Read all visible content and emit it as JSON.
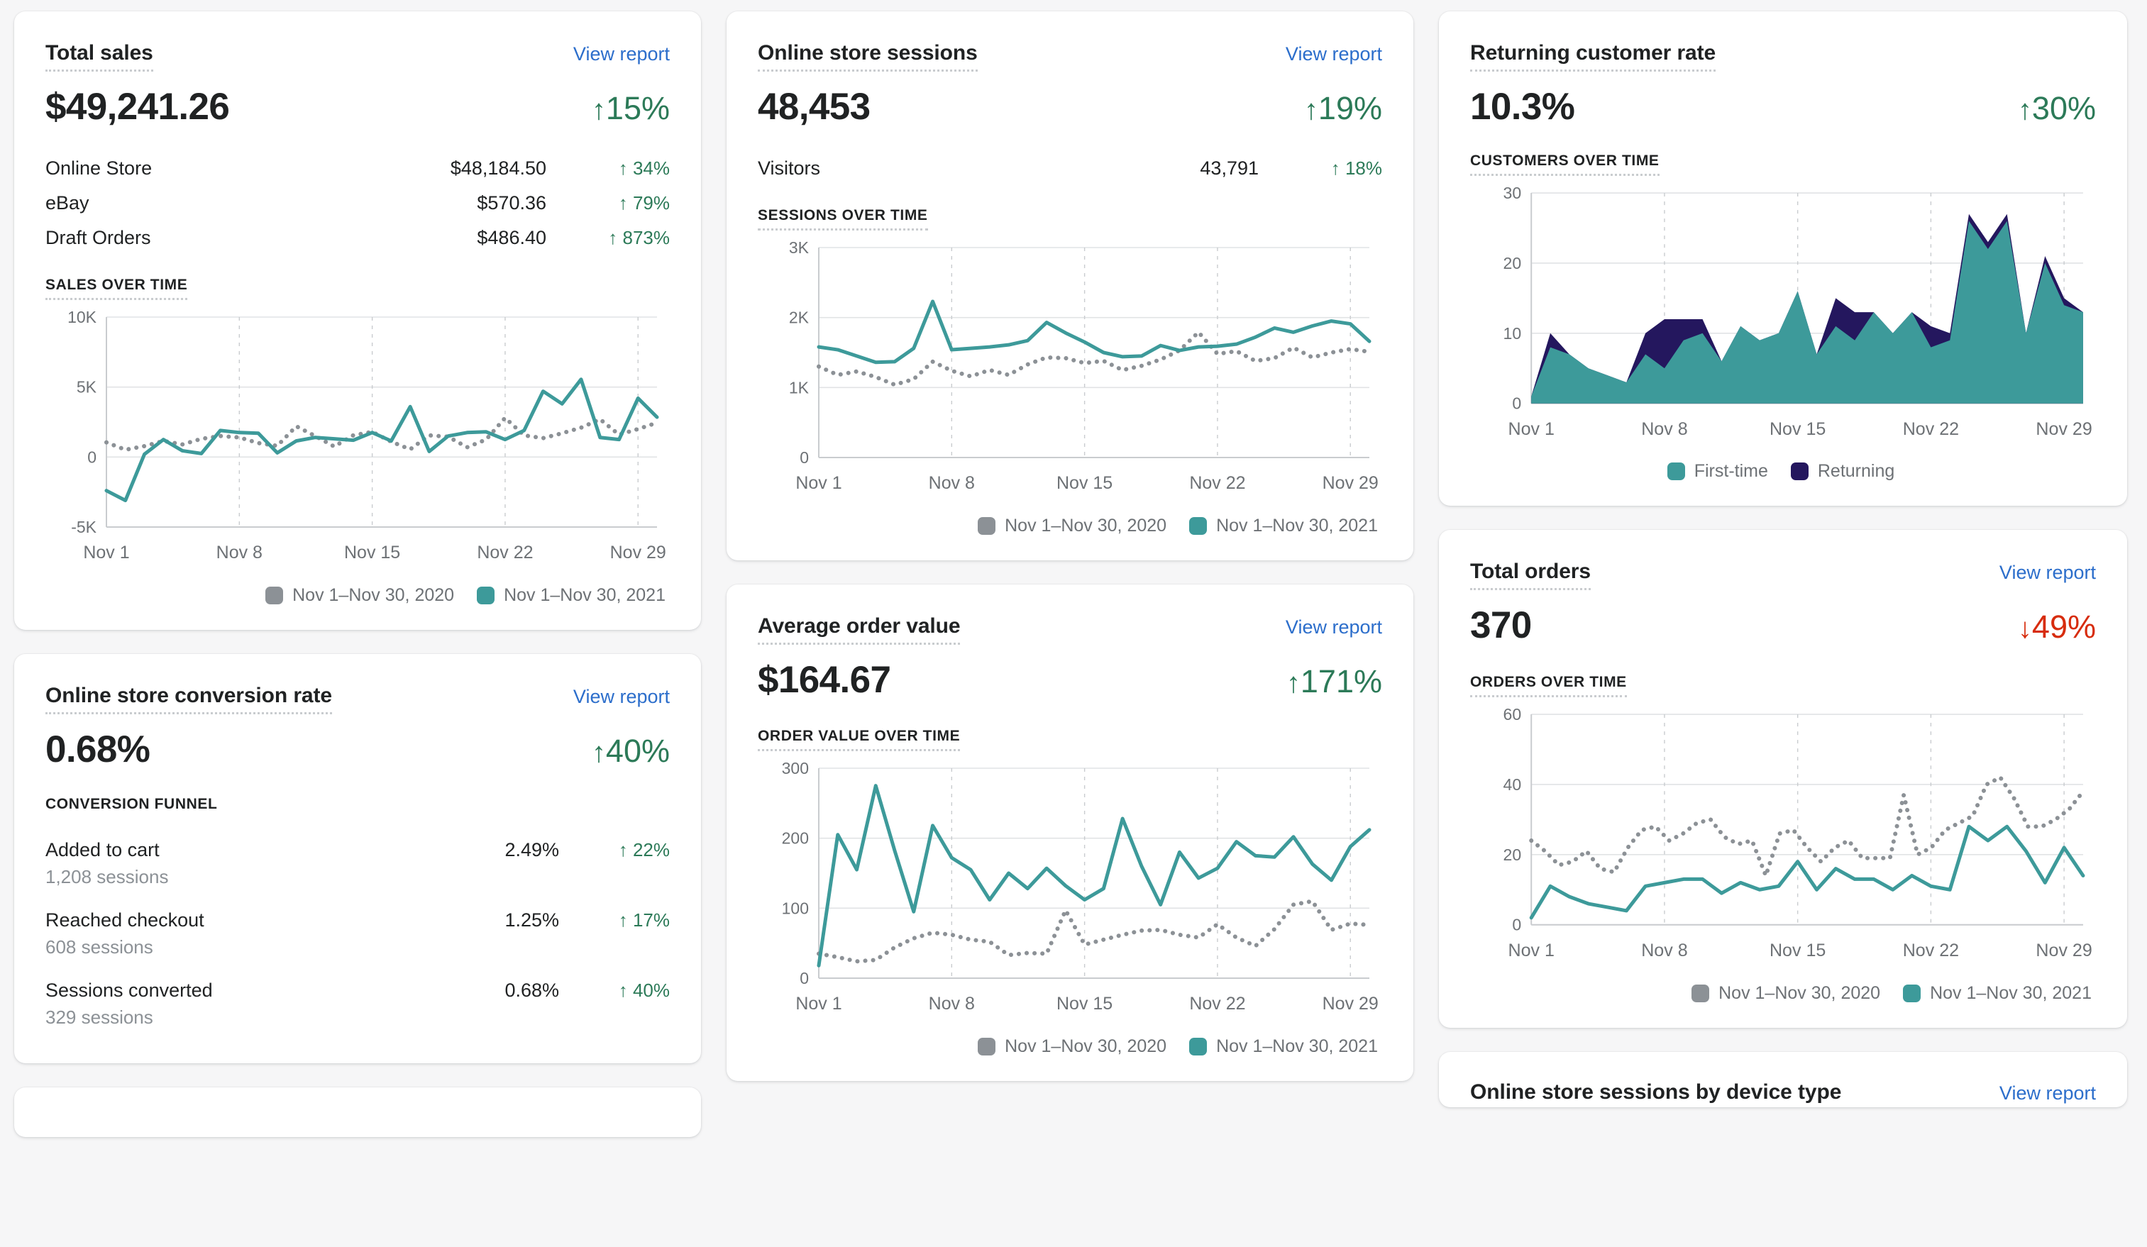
{
  "colors": {
    "accent_teal": "#3d9a9a",
    "accent_navy": "#24175e",
    "compare_gray": "#8c9196",
    "positive": "#2c7a58",
    "negative": "#d72c0d",
    "link": "#2c6ecb",
    "text": "#202223",
    "page_bg": "#f6f6f7"
  },
  "common": {
    "view_report": "View report",
    "legend_2020": "Nov 1–Nov 30, 2020",
    "legend_2021": "Nov 1–Nov 30, 2021",
    "x_ticks": [
      "Nov 1",
      "Nov 8",
      "Nov 15",
      "Nov 22",
      "Nov 29"
    ]
  },
  "cards": {
    "total_sales": {
      "title": "Total sales",
      "value": "$49,241.26",
      "delta": "15%",
      "delta_dir": "up",
      "delta_arrow": "↑",
      "rows": [
        {
          "label": "Online Store",
          "value": "$48,184.50",
          "change": "34%",
          "dir": "up",
          "arrow": "↑"
        },
        {
          "label": "eBay",
          "value": "$570.36",
          "change": "79%",
          "dir": "up",
          "arrow": "↑"
        },
        {
          "label": "Draft Orders",
          "value": "$486.40",
          "change": "873%",
          "dir": "up",
          "arrow": "↑"
        }
      ],
      "chart_label": "SALES OVER TIME"
    },
    "conversion_rate": {
      "title": "Online store conversion rate",
      "value": "0.68%",
      "delta": "40%",
      "delta_dir": "up",
      "delta_arrow": "↑",
      "funnel_label": "CONVERSION FUNNEL",
      "funnel": [
        {
          "label": "Added to cart",
          "sub": "1,208 sessions",
          "value": "2.49%",
          "change": "22%",
          "dir": "up",
          "arrow": "↑"
        },
        {
          "label": "Reached checkout",
          "sub": "608 sessions",
          "value": "1.25%",
          "change": "17%",
          "dir": "up",
          "arrow": "↑"
        },
        {
          "label": "Sessions converted",
          "sub": "329 sessions",
          "value": "0.68%",
          "change": "40%",
          "dir": "up",
          "arrow": "↑"
        }
      ]
    },
    "sessions": {
      "title": "Online store sessions",
      "value": "48,453",
      "delta": "19%",
      "delta_dir": "up",
      "delta_arrow": "↑",
      "rows": [
        {
          "label": "Visitors",
          "value": "43,791",
          "change": "18%",
          "dir": "up",
          "arrow": "↑"
        }
      ],
      "chart_label": "SESSIONS OVER TIME"
    },
    "average_order_value": {
      "title": "Average order value",
      "value": "$164.67",
      "delta": "171%",
      "delta_dir": "up",
      "delta_arrow": "↑",
      "chart_label": "ORDER VALUE OVER TIME"
    },
    "returning_customer_rate": {
      "title": "Returning customer rate",
      "value": "10.3%",
      "delta": "30%",
      "delta_dir": "up",
      "delta_arrow": "↑",
      "chart_label": "CUSTOMERS OVER TIME",
      "legend_first": "First-time",
      "legend_returning": "Returning"
    },
    "total_orders": {
      "title": "Total orders",
      "value": "370",
      "delta": "49%",
      "delta_dir": "down",
      "delta_arrow": "↓",
      "chart_label": "ORDERS OVER TIME"
    },
    "device_type": {
      "title": "Online store sessions by device type"
    }
  },
  "chart_data": [
    {
      "id": "sales_over_time",
      "type": "line",
      "title": "SALES OVER TIME",
      "xlabel": "",
      "ylabel": "",
      "ylim": [
        -5000,
        10000
      ],
      "y_ticks": [
        "-5K",
        "0",
        "5K",
        "10K"
      ],
      "y_tick_values": [
        -5000,
        0,
        5000,
        10000
      ],
      "x": [
        "Nov 1",
        "Nov 2",
        "Nov 3",
        "Nov 4",
        "Nov 5",
        "Nov 6",
        "Nov 7",
        "Nov 8",
        "Nov 9",
        "Nov 10",
        "Nov 11",
        "Nov 12",
        "Nov 13",
        "Nov 14",
        "Nov 15",
        "Nov 16",
        "Nov 17",
        "Nov 18",
        "Nov 19",
        "Nov 20",
        "Nov 21",
        "Nov 22",
        "Nov 23",
        "Nov 24",
        "Nov 25",
        "Nov 26",
        "Nov 27",
        "Nov 28",
        "Nov 29",
        "Nov 30"
      ],
      "x_ticks": [
        "Nov 1",
        "Nov 8",
        "Nov 15",
        "Nov 22",
        "Nov 29"
      ],
      "grid": true,
      "legend_position": "bottom-right",
      "series": [
        {
          "name": "Nov 1–Nov 30, 2020",
          "style": "dotted",
          "color": "#8c9196",
          "values": [
            1050,
            520,
            780,
            1150,
            900,
            1300,
            1500,
            1400,
            1000,
            800,
            2200,
            1500,
            750,
            1550,
            1800,
            1100,
            550,
            1550,
            1450,
            700,
            1250,
            2800,
            1550,
            1350,
            1700,
            2100,
            2700,
            1600,
            2000,
            2450
          ]
        },
        {
          "name": "Nov 1–Nov 30, 2021",
          "style": "solid",
          "color": "#3d9a9a",
          "values": [
            -2400,
            -3100,
            200,
            1250,
            450,
            250,
            1900,
            1750,
            1700,
            300,
            1150,
            1400,
            1300,
            1200,
            1750,
            1150,
            3600,
            400,
            1500,
            1750,
            1800,
            1250,
            1900,
            4700,
            3800,
            5550,
            1400,
            1250,
            4200,
            2850
          ]
        }
      ]
    },
    {
      "id": "sessions_over_time",
      "type": "line",
      "title": "SESSIONS OVER TIME",
      "ylim": [
        0,
        3000
      ],
      "y_ticks": [
        "0",
        "1K",
        "2K",
        "3K"
      ],
      "y_tick_values": [
        0,
        1000,
        2000,
        3000
      ],
      "x_ticks": [
        "Nov 1",
        "Nov 8",
        "Nov 15",
        "Nov 22",
        "Nov 29"
      ],
      "grid": true,
      "legend_position": "bottom-right",
      "series": [
        {
          "name": "Nov 1–Nov 30, 2020",
          "style": "dotted",
          "color": "#8c9196",
          "values": [
            1300,
            1180,
            1230,
            1150,
            1040,
            1120,
            1370,
            1240,
            1160,
            1250,
            1180,
            1330,
            1430,
            1420,
            1350,
            1380,
            1250,
            1310,
            1400,
            1530,
            1790,
            1480,
            1520,
            1380,
            1420,
            1570,
            1430,
            1500,
            1550,
            1510
          ]
        },
        {
          "name": "Nov 1–Nov 30, 2021",
          "style": "solid",
          "color": "#3d9a9a",
          "values": [
            1580,
            1540,
            1450,
            1360,
            1370,
            1560,
            2230,
            1540,
            1560,
            1580,
            1610,
            1670,
            1930,
            1780,
            1650,
            1500,
            1440,
            1450,
            1600,
            1530,
            1580,
            1590,
            1620,
            1720,
            1850,
            1790,
            1880,
            1950,
            1910,
            1660
          ]
        }
      ]
    },
    {
      "id": "order_value_over_time",
      "type": "line",
      "title": "ORDER VALUE OVER TIME",
      "ylim": [
        0,
        300
      ],
      "y_ticks": [
        "0",
        "100",
        "200",
        "300"
      ],
      "y_tick_values": [
        0,
        100,
        200,
        300
      ],
      "x_ticks": [
        "Nov 1",
        "Nov 8",
        "Nov 15",
        "Nov 22",
        "Nov 29"
      ],
      "grid": true,
      "legend_position": "bottom-right",
      "series": [
        {
          "name": "Nov 1–Nov 30, 2020",
          "style": "dotted",
          "color": "#8c9196",
          "values": [
            35,
            30,
            24,
            26,
            44,
            57,
            65,
            62,
            55,
            52,
            33,
            36,
            35,
            97,
            48,
            55,
            62,
            68,
            69,
            62,
            58,
            77,
            58,
            46,
            70,
            105,
            110,
            69,
            78,
            76
          ]
        },
        {
          "name": "Nov 1–Nov 30, 2021",
          "style": "solid",
          "color": "#3d9a9a",
          "values": [
            18,
            205,
            155,
            275,
            182,
            95,
            218,
            172,
            155,
            112,
            150,
            128,
            157,
            132,
            112,
            128,
            228,
            160,
            105,
            180,
            143,
            157,
            195,
            175,
            173,
            202,
            163,
            140,
            188,
            212
          ]
        }
      ]
    },
    {
      "id": "customers_over_time",
      "type": "area",
      "title": "CUSTOMERS OVER TIME",
      "stacked": true,
      "ylim": [
        0,
        30
      ],
      "y_ticks": [
        "0",
        "10",
        "20",
        "30"
      ],
      "y_tick_values": [
        0,
        10,
        20,
        30
      ],
      "x_ticks": [
        "Nov 1",
        "Nov 8",
        "Nov 15",
        "Nov 22",
        "Nov 29"
      ],
      "grid": true,
      "legend_position": "bottom-right",
      "series": [
        {
          "name": "First-time",
          "color": "#3d9a9a",
          "values": [
            1,
            8,
            7,
            5,
            4,
            3,
            7,
            5,
            9,
            10,
            6,
            11,
            9,
            10,
            16,
            7,
            11,
            9,
            13,
            10,
            13,
            8,
            9,
            26,
            22,
            26,
            10,
            20,
            14,
            13
          ]
        },
        {
          "name": "Returning",
          "color": "#24175e",
          "values": [
            0,
            2,
            0,
            0,
            0,
            0,
            3,
            7,
            3,
            2,
            0,
            0,
            0,
            0,
            0,
            0,
            4,
            4,
            0,
            0,
            0,
            3,
            1,
            1,
            1,
            1,
            0,
            1,
            1,
            0
          ]
        }
      ]
    },
    {
      "id": "orders_over_time",
      "type": "line",
      "title": "ORDERS OVER TIME",
      "ylim": [
        0,
        60
      ],
      "y_ticks": [
        "0",
        "20",
        "40",
        "60"
      ],
      "y_tick_values": [
        0,
        20,
        40,
        60
      ],
      "x_ticks": [
        "Nov 1",
        "Nov 8",
        "Nov 15",
        "Nov 22",
        "Nov 29"
      ],
      "grid": true,
      "legend_position": "bottom-right",
      "series": [
        {
          "name": "Nov 1–Nov 30, 2020",
          "style": "dotted",
          "color": "#8c9196",
          "values": [
            24,
            21,
            17,
            18,
            21,
            16,
            15,
            22,
            27,
            28,
            24,
            26,
            29,
            30,
            25,
            23,
            24,
            14,
            26,
            27,
            22,
            18,
            22,
            24,
            19,
            19,
            19,
            37,
            20,
            22,
            27,
            29,
            31,
            40,
            42,
            36,
            28,
            28,
            30,
            33,
            38
          ]
        },
        {
          "name": "Nov 1–Nov 30, 2021",
          "style": "solid",
          "color": "#3d9a9a",
          "values": [
            2,
            11,
            8,
            6,
            5,
            4,
            11,
            12,
            13,
            13,
            9,
            12,
            10,
            11,
            18,
            10,
            16,
            13,
            13,
            10,
            14,
            11,
            10,
            28,
            24,
            28,
            21,
            12,
            22,
            14
          ]
        }
      ]
    }
  ]
}
